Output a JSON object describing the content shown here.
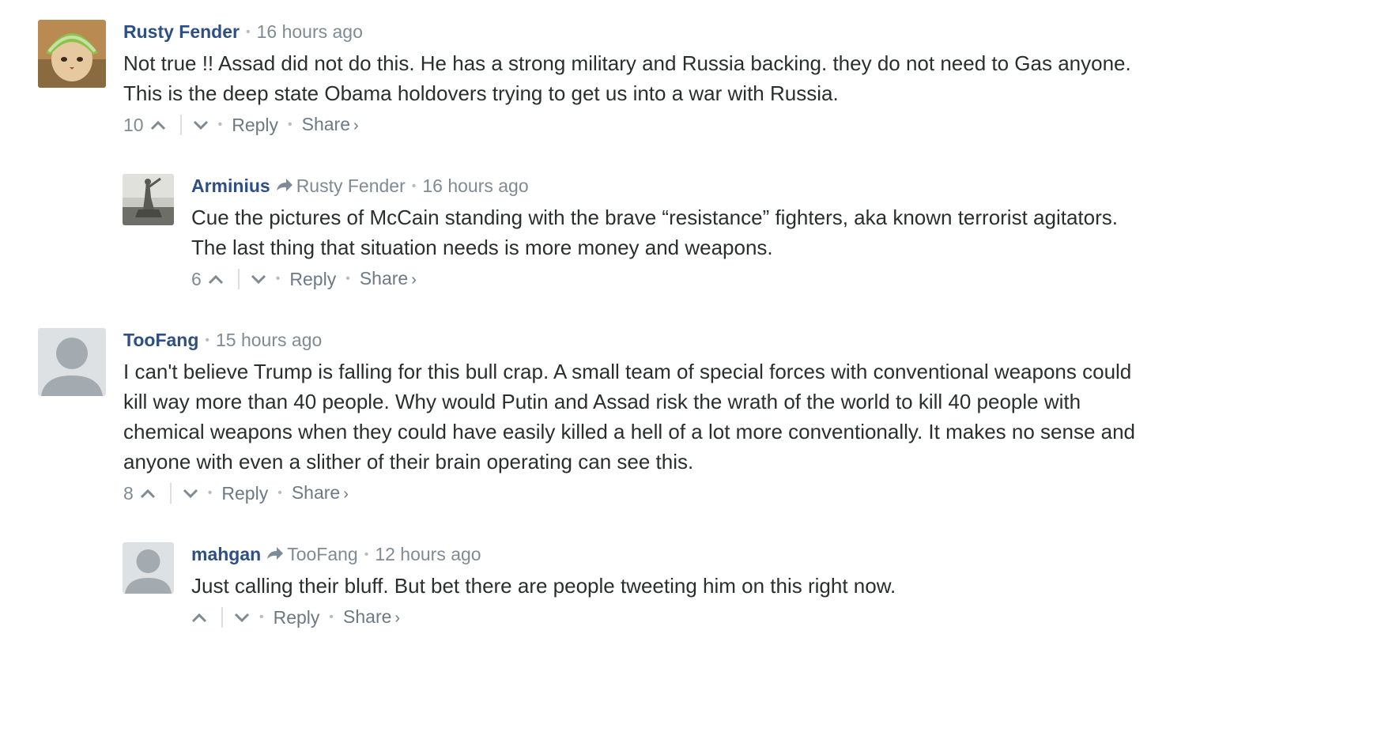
{
  "comments": [
    {
      "author": "Rusty Fender",
      "parent": "",
      "time": "16 hours ago",
      "lines": [
        "Not true !! Assad did not do this. He has a strong military and Russia backing. they do not need to Gas anyone.",
        "This is the deep state Obama holdovers trying to get us into a war with Russia."
      ],
      "votes": "10",
      "reply_label": "Reply",
      "share_label": "Share",
      "avatar_icon": "cat-with-melon-hat-avatar"
    },
    {
      "author": "Arminius",
      "parent": "Rusty Fender",
      "time": "16 hours ago",
      "lines": [
        "Cue the pictures of McCain standing with the brave “resistance” fighters, aka known terrorist agitators.",
        "The last thing that situation needs is more money and weapons."
      ],
      "votes": "6",
      "reply_label": "Reply",
      "share_label": "Share",
      "avatar_icon": "statue-avatar"
    },
    {
      "author": "TooFang",
      "parent": "",
      "time": "15 hours ago",
      "lines": [
        "I can't believe Trump is falling for this bull crap. A small team of special forces with conventional weapons could",
        "kill way more than 40 people. Why would Putin and Assad risk the wrath of the world to kill 40 people with",
        "chemical weapons when they could have easily killed a hell of a lot more conventionally. It makes no sense and",
        "anyone with even a slither of their brain operating can see this."
      ],
      "votes": "8",
      "reply_label": "Reply",
      "share_label": "Share",
      "avatar_icon": "default-user-avatar"
    },
    {
      "author": "mahgan",
      "parent": "TooFang",
      "time": "12 hours ago",
      "lines": [
        "Just calling their bluff. But bet there are people tweeting him on this right now."
      ],
      "votes": "",
      "reply_label": "Reply",
      "share_label": "Share",
      "avatar_icon": "default-user-avatar"
    }
  ],
  "colors": {
    "author": "#2e4f85",
    "meta": "#7f8b94",
    "text": "#2a2e2e"
  }
}
